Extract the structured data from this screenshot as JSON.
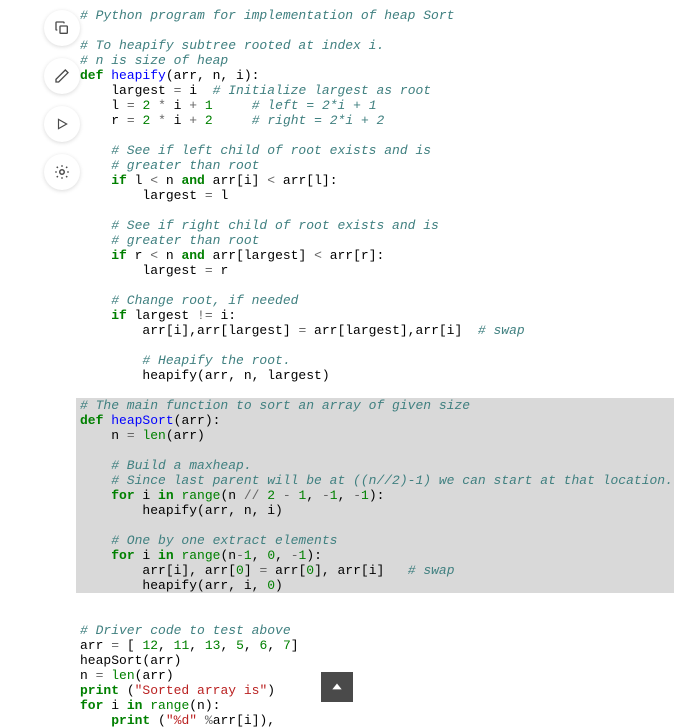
{
  "toolbar": {
    "copy": "copy-icon",
    "edit": "edit-icon",
    "run": "run-icon",
    "theme": "theme-icon"
  },
  "code": {
    "l01": "# Python program for implementation of heap Sort",
    "l02": "",
    "l03": "# To heapify subtree rooted at index i.",
    "l04": "# n is size of heap",
    "l05_def": "def",
    "l05_fn": "heapify",
    "l05_rest": "(arr, n, i):",
    "l06_a": "    largest ",
    "l06_op": "=",
    "l06_b": " i  ",
    "l06_c": "# Initialize largest as root",
    "l07_a": "    l ",
    "l07_op1": "=",
    "l07_b": " ",
    "l07_n1": "2",
    "l07_c": " ",
    "l07_op2": "*",
    "l07_d": " i ",
    "l07_op3": "+",
    "l07_e": " ",
    "l07_n2": "1",
    "l07_f": "     ",
    "l07_cm": "# left = 2*i + 1",
    "l08_a": "    r ",
    "l08_op1": "=",
    "l08_b": " ",
    "l08_n1": "2",
    "l08_c": " ",
    "l08_op2": "*",
    "l08_d": " i ",
    "l08_op3": "+",
    "l08_e": " ",
    "l08_n2": "2",
    "l08_f": "     ",
    "l08_cm": "# right = 2*i + 2",
    "l09": "",
    "l10": "    # See if left child of root exists and is",
    "l11": "    # greater than root",
    "l12_a": "    ",
    "l12_if": "if",
    "l12_b": " l ",
    "l12_op1": "<",
    "l12_c": " n ",
    "l12_and": "and",
    "l12_d": " arr[i] ",
    "l12_op2": "<",
    "l12_e": " arr[l]:",
    "l13_a": "        largest ",
    "l13_op": "=",
    "l13_b": " l",
    "l14": "",
    "l15": "    # See if right child of root exists and is",
    "l16": "    # greater than root",
    "l17_a": "    ",
    "l17_if": "if",
    "l17_b": " r ",
    "l17_op1": "<",
    "l17_c": " n ",
    "l17_and": "and",
    "l17_d": " arr[largest] ",
    "l17_op2": "<",
    "l17_e": " arr[r]:",
    "l18_a": "        largest ",
    "l18_op": "=",
    "l18_b": " r",
    "l19": "",
    "l20": "    # Change root, if needed",
    "l21_a": "    ",
    "l21_if": "if",
    "l21_b": " largest ",
    "l21_op": "!=",
    "l21_c": " i:",
    "l22_a": "        arr[i],arr[largest] ",
    "l22_op": "=",
    "l22_b": " arr[largest],arr[i]  ",
    "l22_cm": "# swap",
    "l23": "",
    "l24": "        # Heapify the root.",
    "l25": "        heapify(arr, n, largest)",
    "l26": "",
    "l27": "# The main function to sort an array of given size",
    "l28_def": "def",
    "l28_fn": "heapSort",
    "l28_rest": "(arr):",
    "l29_a": "    n ",
    "l29_op": "=",
    "l29_b": " ",
    "l29_len": "len",
    "l29_c": "(arr)",
    "l30": "",
    "l31": "    # Build a maxheap.",
    "l32": "    # Since last parent will be at ((n//2)-1) we can start at that location.",
    "l33_a": "    ",
    "l33_for": "for",
    "l33_b": " i ",
    "l33_in": "in",
    "l33_c": " ",
    "l33_range": "range",
    "l33_d": "(n ",
    "l33_op1": "//",
    "l33_e": " ",
    "l33_n1": "2",
    "l33_f": " ",
    "l33_op2": "-",
    "l33_g": " ",
    "l33_n2": "1",
    "l33_h": ", ",
    "l33_op3": "-",
    "l33_n3": "1",
    "l33_i": ", ",
    "l33_op4": "-",
    "l33_n4": "1",
    "l33_j": "):",
    "l34": "        heapify(arr, n, i)",
    "l35": "",
    "l36": "    # One by one extract elements",
    "l37_a": "    ",
    "l37_for": "for",
    "l37_b": " i ",
    "l37_in": "in",
    "l37_c": " ",
    "l37_range": "range",
    "l37_d": "(n",
    "l37_op1": "-",
    "l37_n1": "1",
    "l37_e": ", ",
    "l37_n2": "0",
    "l37_f": ", ",
    "l37_op2": "-",
    "l37_n3": "1",
    "l37_g": "):",
    "l38_a": "        arr[i], arr[",
    "l38_n1": "0",
    "l38_b": "] ",
    "l38_op": "=",
    "l38_c": " arr[",
    "l38_n2": "0",
    "l38_d": "], arr[i]   ",
    "l38_cm": "# swap",
    "l39_a": "        heapify(arr, i, ",
    "l39_n": "0",
    "l39_b": ")",
    "l40": "",
    "l41": "# Driver code to test above",
    "l42_a": "arr ",
    "l42_op": "=",
    "l42_b": " [ ",
    "l42_n1": "12",
    "l42_c": ", ",
    "l42_n2": "11",
    "l42_d": ", ",
    "l42_n3": "13",
    "l42_e": ", ",
    "l42_n4": "5",
    "l42_f": ", ",
    "l42_n5": "6",
    "l42_g": ", ",
    "l42_n6": "7",
    "l42_h": "]",
    "l43": "heapSort(arr)",
    "l44_a": "n ",
    "l44_op": "=",
    "l44_b": " ",
    "l44_len": "len",
    "l44_c": "(arr)",
    "l45_print": "print",
    "l45_a": " (",
    "l45_str": "\"Sorted array is\"",
    "l45_b": ")",
    "l46_for": "for",
    "l46_a": " i ",
    "l46_in": "in",
    "l46_b": " ",
    "l46_range": "range",
    "l46_c": "(n):",
    "l47_a": "    ",
    "l47_print": "print",
    "l47_b": " (",
    "l47_str": "\"%d\"",
    "l47_c": " ",
    "l47_op": "%",
    "l47_d": "arr[i]),"
  }
}
